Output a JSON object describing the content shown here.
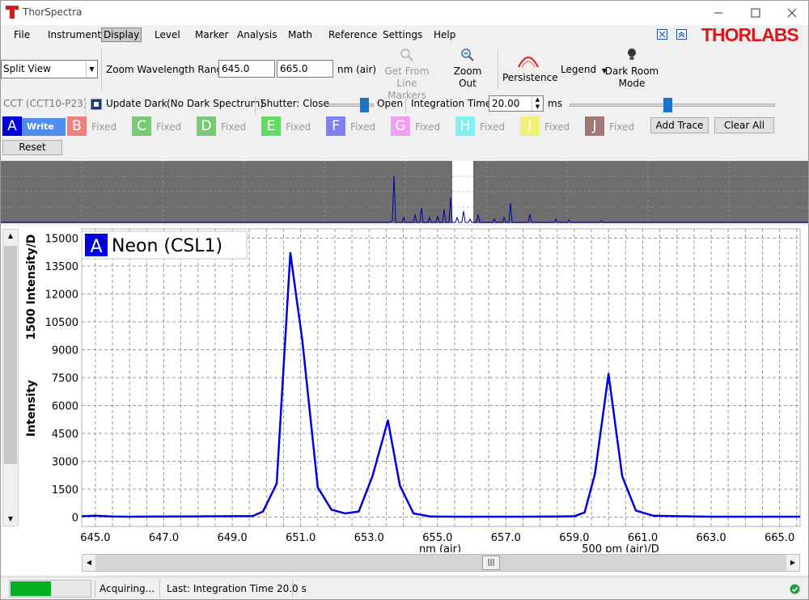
{
  "window": {
    "title": "ThorSpectra"
  },
  "menu": [
    "File",
    "Instrument",
    "Display",
    "Level",
    "Marker",
    "Analysis",
    "Math",
    "Reference",
    "Settings",
    "Help"
  ],
  "menu_active": "Display",
  "brand": "THORLABS",
  "toolbar": {
    "view_mode": "Split View",
    "zoom_label": "Zoom Wavelength Range",
    "zoom_from": "645.0",
    "zoom_to": "665.0",
    "zoom_unit": "nm (air)",
    "get_from_line1": "Get From",
    "get_from_line2": "Line Markers",
    "zoom_out_line1": "Zoom",
    "zoom_out_line2": "Out",
    "persistence": "Persistence",
    "legend": "Legend",
    "dark_room_line1": "Dark Room",
    "dark_room_line2": "Mode"
  },
  "device": {
    "name": "CCT (CCT10-P23)",
    "update_dark": "Update Dark",
    "dark_status": "(No Dark Spectrum)",
    "shutter_label": "Shutter: Close",
    "shutter_open": "Open",
    "integration_label": "Integration Time:",
    "integration_value": "20.00",
    "integration_unit": "ms"
  },
  "traces": [
    {
      "letter": "A",
      "mode": "Write",
      "color": "#0000dd"
    },
    {
      "letter": "B",
      "mode": "Fixed",
      "color": "#f08080"
    },
    {
      "letter": "C",
      "mode": "Fixed",
      "color": "#78c878"
    },
    {
      "letter": "D",
      "mode": "Fixed",
      "color": "#78c878"
    },
    {
      "letter": "E",
      "mode": "Fixed",
      "color": "#64dc64"
    },
    {
      "letter": "F",
      "mode": "Fixed",
      "color": "#8080f0"
    },
    {
      "letter": "G",
      "mode": "Fixed",
      "color": "#f0a0f0"
    },
    {
      "letter": "H",
      "mode": "Fixed",
      "color": "#80f0f0"
    },
    {
      "letter": "I",
      "mode": "Fixed",
      "color": "#f0f078"
    },
    {
      "letter": "J",
      "mode": "Fixed",
      "color": "#a07878"
    }
  ],
  "buttons": {
    "add_trace": "Add Trace",
    "clear_all": "Clear All",
    "reset": "Reset"
  },
  "chart_data": {
    "type": "line",
    "title": "",
    "legend_letter": "A",
    "legend_text": "Neon (CSL1)",
    "ylabel": "Intensity",
    "ylabel_div": "1500 Intensity/D",
    "xlabel": "nm (air)",
    "xlabel_div": "500 pm (air)/D",
    "xlim": [
      644.6,
      665.6
    ],
    "ylim": [
      -500,
      15500
    ],
    "x_ticks": [
      "645.0",
      "647.0",
      "649.0",
      "651.0",
      "653.0",
      "655.0",
      "657.0",
      "659.0",
      "661.0",
      "663.0",
      "665.0"
    ],
    "y_ticks": [
      "15000",
      "13500",
      "12000",
      "10500",
      "9000",
      "7500",
      "6000",
      "4500",
      "3000",
      "1500",
      "0"
    ],
    "grid": true,
    "series": [
      {
        "color": "#0000dd",
        "x": [
          644.6,
          645.0,
          645.5,
          646.0,
          647.0,
          648.0,
          649.0,
          649.6,
          649.9,
          650.3,
          650.7,
          651.05,
          651.5,
          651.9,
          652.3,
          652.7,
          653.1,
          653.55,
          653.9,
          654.3,
          654.8,
          655.5,
          656.5,
          657.5,
          658.5,
          659.0,
          659.3,
          659.6,
          660.0,
          660.4,
          660.8,
          661.3,
          662.0,
          663.0,
          664.0,
          665.0,
          665.6
        ],
        "y": [
          50,
          80,
          30,
          20,
          30,
          40,
          50,
          60,
          300,
          1800,
          14200,
          9500,
          1600,
          400,
          200,
          300,
          2200,
          5200,
          1700,
          200,
          30,
          20,
          20,
          20,
          30,
          50,
          250,
          2300,
          7700,
          2200,
          350,
          80,
          50,
          20,
          20,
          20,
          20
        ]
      }
    ]
  },
  "status": {
    "acquiring": "Acquiring...",
    "last": "Last: Integration Time 20.0 s",
    "progress": 0.5
  }
}
